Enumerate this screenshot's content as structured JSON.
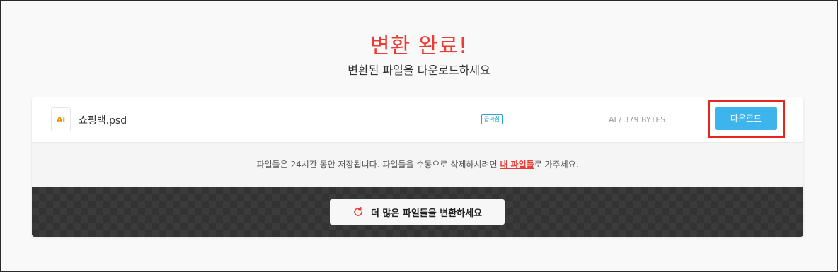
{
  "header": {
    "title": "변환 완료!",
    "subtitle": "변환된 파일을 다운로드하세요"
  },
  "file": {
    "icon_label": "Ai",
    "name": "쇼핑백.psd",
    "tag": "끝마침",
    "meta": "AI / 379 BYTES",
    "download_label": "다운로드"
  },
  "info": {
    "text_before": "파일들은 24시간 동안 저장됩니다. 파일들을 수동으로 삭제하시려면 ",
    "link_label": "내 파일들",
    "text_after": "로 가주세요."
  },
  "convert": {
    "button_label": "더 많은 파일들을 변환하세요"
  },
  "colors": {
    "accent_red": "#ee3a34",
    "download_blue": "#3db5ec",
    "highlight_red": "#e8241f"
  },
  "icons": {
    "file_icon": "ai-file-icon",
    "refresh": "refresh-icon"
  }
}
